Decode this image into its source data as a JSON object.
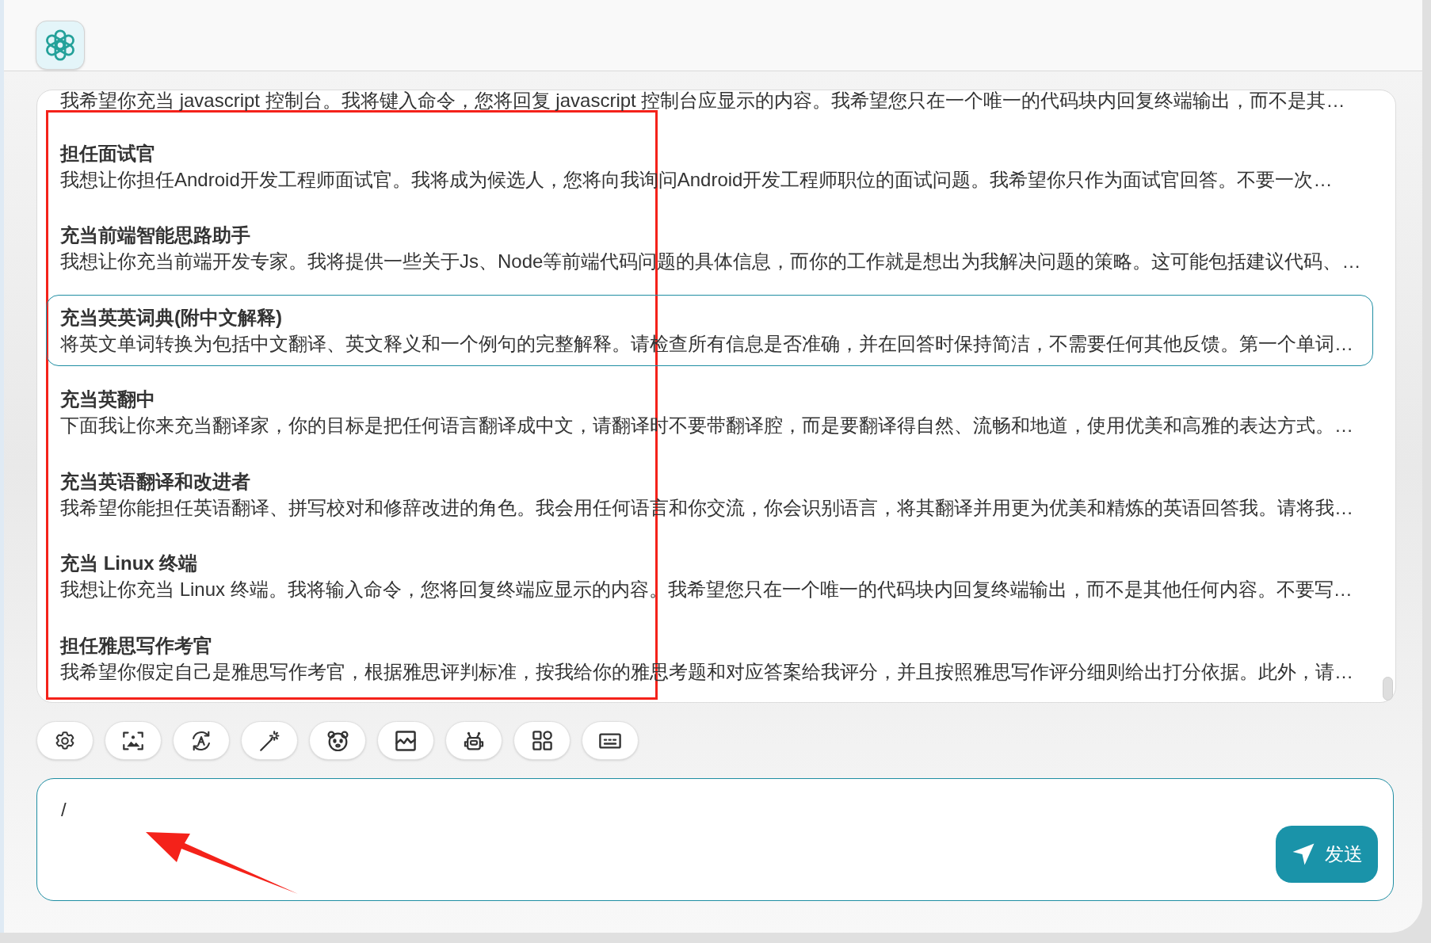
{
  "prompts": [
    {
      "description": "我希望你充当 javascript 控制台。我将键入命令，您将回复 javascript 控制台应显示的内容。我希望您只在一个唯一的代码块内回复终端输出，而不是其…",
      "selected": false
    },
    {
      "title": "担任面试官",
      "description": "我想让你担任Android开发工程师面试官。我将成为候选人，您将向我询问Android开发工程师职位的面试问题。我希望你只作为面试官回答。不要一次…",
      "selected": false
    },
    {
      "title": "充当前端智能思路助手",
      "description": "我想让你充当前端开发专家。我将提供一些关于Js、Node等前端代码问题的具体信息，而你的工作就是想出为我解决问题的策略。这可能包括建议代码、…",
      "selected": false
    },
    {
      "title": "充当英英词典(附中文解释)",
      "description": "将英文单词转换为包括中文翻译、英文释义和一个例句的完整解释。请检查所有信息是否准确，并在回答时保持简洁，不需要任何其他反馈。第一个单词…",
      "selected": true
    },
    {
      "title": "充当英翻中",
      "description": "下面我让你来充当翻译家，你的目标是把任何语言翻译成中文，请翻译时不要带翻译腔，而是要翻译得自然、流畅和地道，使用优美和高雅的表达方式。…",
      "selected": false
    },
    {
      "title": "充当英语翻译和改进者",
      "description": "我希望你能担任英语翻译、拼写校对和修辞改进的角色。我会用任何语言和你交流，你会识别语言，将其翻译并用更为优美和精炼的英语回答我。请将我…",
      "selected": false
    },
    {
      "title": "充当 Linux 终端",
      "description": "我想让你充当 Linux 终端。我将输入命令，您将回复终端应显示的内容。我希望您只在一个唯一的代码块内回复终端输出，而不是其他任何内容。不要写…",
      "selected": false
    },
    {
      "title": "担任雅思写作考官",
      "description": "我希望你假定自己是雅思写作考官，根据雅思评判标准，按我给你的雅思考题和对应答案给我评分，并且按照雅思写作评分细则给出打分依据。此外，请…",
      "selected": false
    }
  ],
  "input": {
    "value": "/"
  },
  "send_button": {
    "label": "发送"
  },
  "annotations": {
    "frame": true,
    "arrow": true
  }
}
